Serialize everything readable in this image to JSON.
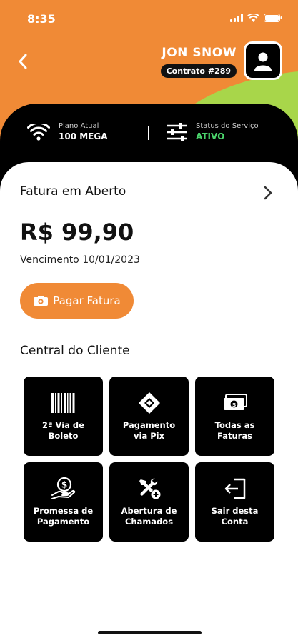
{
  "status_bar": {
    "time": "8:35"
  },
  "header": {
    "user_name": "JON SNOW",
    "contract": "Contrato #289"
  },
  "info": {
    "plan_label": "Plano Atual",
    "plan_value": "100 MEGA",
    "service_label": "Status do Serviço",
    "service_value": "ATIVO"
  },
  "invoice": {
    "title": "Fatura em Aberto",
    "amount": "R$ 99,90",
    "due": "Vencimento 10/01/2023",
    "pay_label": "Pagar Fatura"
  },
  "central": {
    "title": "Central do Cliente",
    "tiles": [
      {
        "label": "2ª Via de\nBoleto",
        "icon": "barcode-icon"
      },
      {
        "label": "Pagamento\nvia Pix",
        "icon": "pix-icon"
      },
      {
        "label": "Todas as\nFaturas",
        "icon": "money-icon"
      },
      {
        "label": "Promessa de\nPagamento",
        "icon": "coin-hand-icon"
      },
      {
        "label": "Abertura de\nChamados",
        "icon": "tools-icon"
      },
      {
        "label": "Sair desta\nConta",
        "icon": "logout-icon"
      }
    ]
  },
  "colors": {
    "brand_orange": "#f08a36",
    "accent_green": "#a8d64a",
    "status_active": "#4ad36b"
  }
}
